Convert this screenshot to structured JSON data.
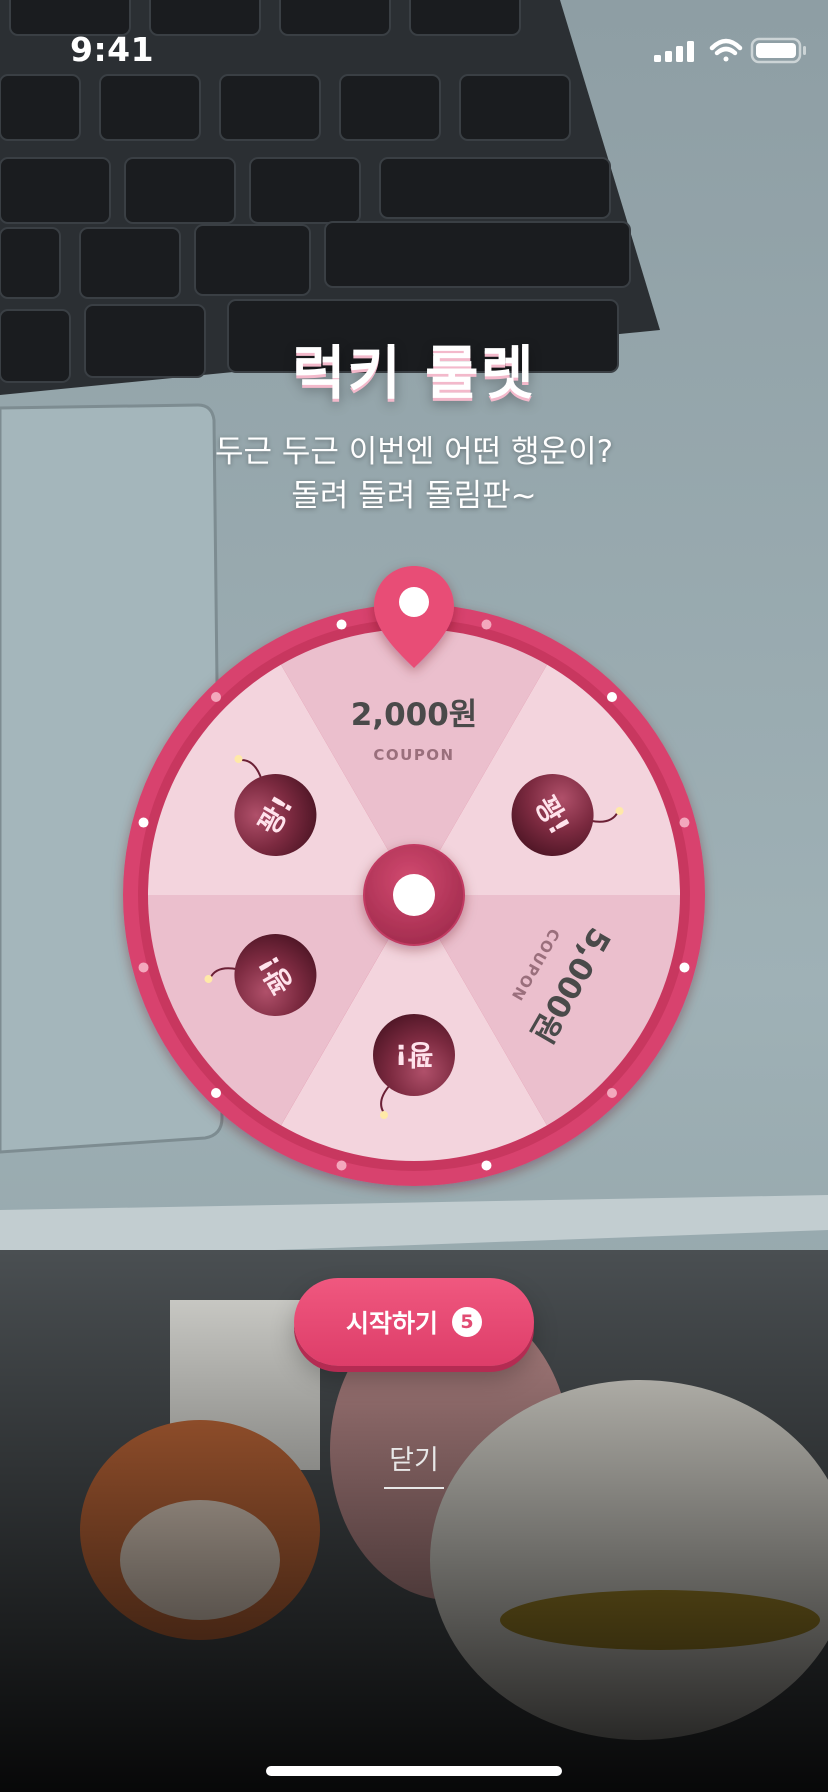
{
  "status_bar": {
    "time": "9:41"
  },
  "header": {
    "title": "럭키 룰렛",
    "subtitle_line1": "두근 두근 이번엔 어떤 행운이?",
    "subtitle_line2": "돌려 돌려 돌림판~"
  },
  "wheel": {
    "segments": [
      {
        "type": "coupon",
        "amount": "2,000원",
        "label": "COUPON"
      },
      {
        "type": "bomb",
        "text": "꽝!"
      },
      {
        "type": "coupon",
        "amount": "5,000원",
        "label": "COUPON"
      },
      {
        "type": "bomb",
        "text": "꽝!"
      },
      {
        "type": "bomb",
        "text": "꽝!"
      },
      {
        "type": "bomb",
        "text": "꽝!"
      }
    ],
    "colors": {
      "rim": "#d8436e",
      "segment_light": "#f3d4dd",
      "segment_dark": "#ebbfcd",
      "bomb": "#7c2a40",
      "pin": "#e84d76"
    }
  },
  "actions": {
    "start_label": "시작하기",
    "remaining_count": "5",
    "close_label": "닫기"
  }
}
